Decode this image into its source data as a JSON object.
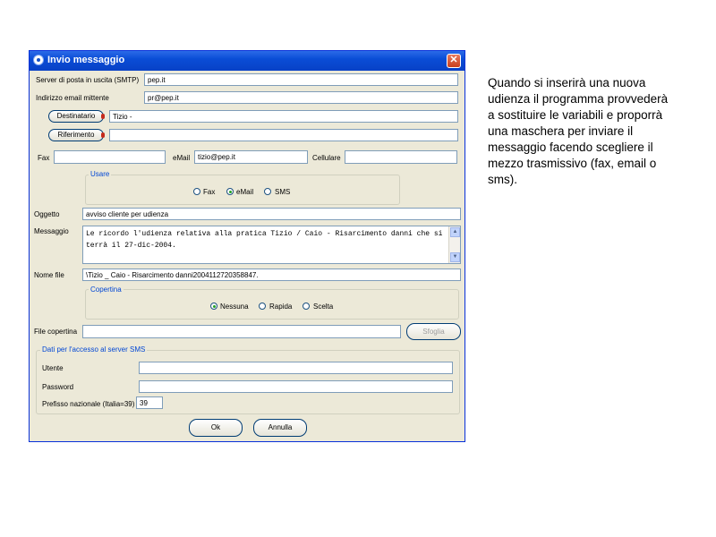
{
  "window": {
    "title": "Invio messaggio",
    "close_glyph": "✕"
  },
  "form": {
    "smtp_label": "Server di posta in uscita (SMTP)",
    "smtp_value": "pep.it",
    "sender_label": "Indirizzo email mittente",
    "sender_value": "pr@pep.it",
    "recipient_button": "Destinatario",
    "recipient_value": "Tizio -",
    "reference_button": "Riferimento",
    "reference_value": "",
    "fax_label": "Fax",
    "fax_value": "",
    "email_label": "eMail",
    "email_value": "tizio@pep.it",
    "cell_label": "Cellulare",
    "cell_value": "",
    "usare": {
      "title": "Usare",
      "options": [
        "Fax",
        "eMail",
        "SMS"
      ],
      "selected": "eMail"
    },
    "subject_label": "Oggetto",
    "subject_value": "avviso cliente per udienza",
    "message_label": "Messaggio",
    "message_value": "Le ricordo l'udienza relativa alla pratica Tizio / Caio - Risarcimento danni che si terrà il 27-dic-2004.",
    "filename_label": "Nome file",
    "filename_value": "\\Tizio _ Caio - Risarcimento danni2004112720358847.",
    "copertina": {
      "title": "Copertina",
      "options": [
        "Nessuna",
        "Rapida",
        "Scelta"
      ],
      "selected": "Nessuna"
    },
    "cover_file_label": "File copertina",
    "cover_file_value": "",
    "browse_button": "Sfoglia",
    "sms": {
      "title": "Dati per l'accesso al server SMS",
      "user_label": "Utente",
      "user_value": "",
      "password_label": "Password",
      "password_value": "",
      "prefix_label": "Prefisso nazionale (Italia=39)",
      "prefix_value": "39"
    },
    "ok_button": "Ok",
    "cancel_button": "Annulla"
  },
  "side_note": "Quando si inserirà una nuova udienza il programma provvederà a sostituire le variabili e proporrà una maschera per inviare il messaggio facendo scegliere il mezzo trasmissivo (fax, email o sms)."
}
